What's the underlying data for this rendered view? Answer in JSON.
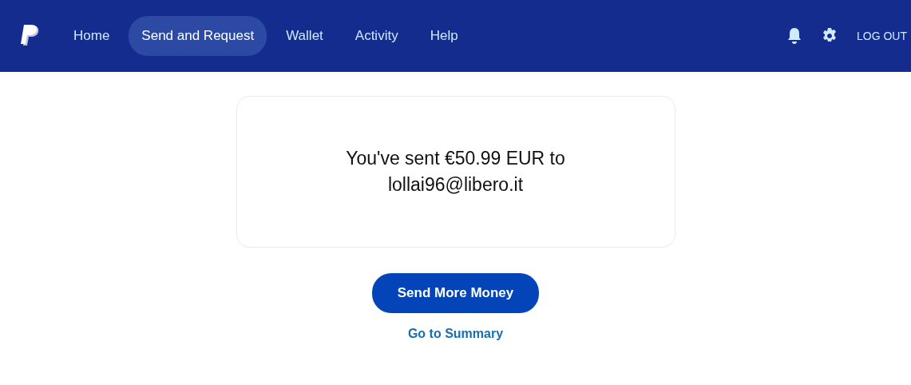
{
  "nav": {
    "items": [
      {
        "label": "Home",
        "selected": false
      },
      {
        "label": "Send and Request",
        "selected": true
      },
      {
        "label": "Wallet",
        "selected": false
      },
      {
        "label": "Activity",
        "selected": false
      },
      {
        "label": "Help",
        "selected": false
      }
    ],
    "logout": "LOG OUT"
  },
  "message": "You've sent €50.99 EUR to lollai96@libero.it",
  "primary_button": "Send More Money",
  "link": "Go to Summary"
}
